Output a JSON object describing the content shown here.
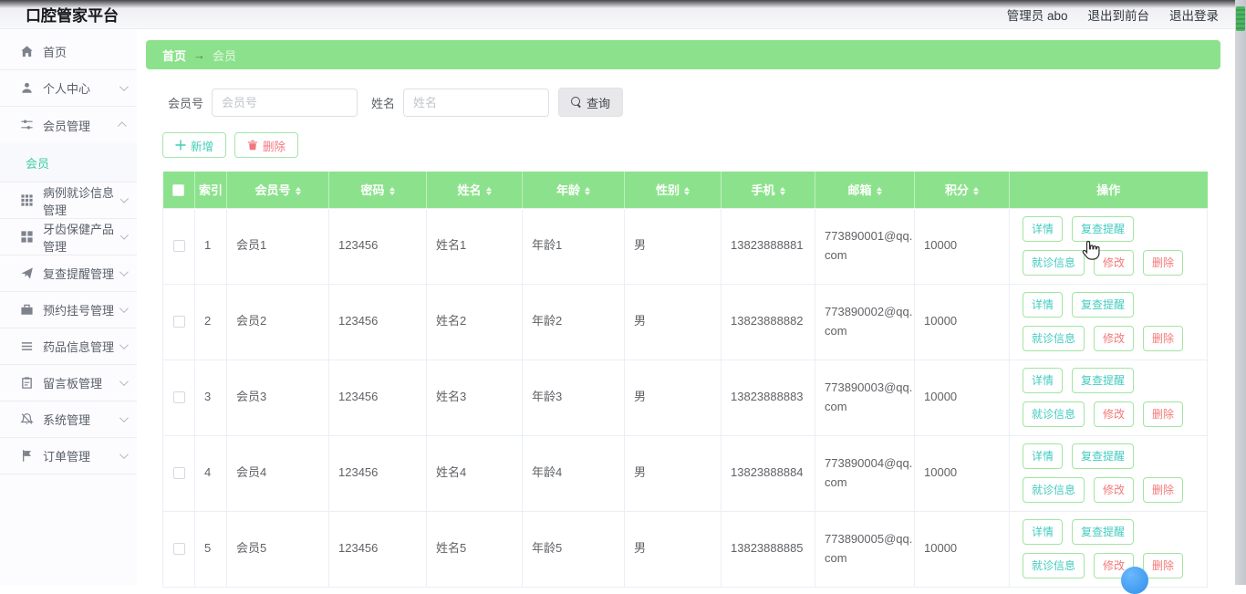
{
  "header": {
    "title": "口腔管家平台",
    "user": "管理员 abo",
    "exit_front_label": "退出到前台",
    "logout_label": "退出登录"
  },
  "sidebar": {
    "items": [
      {
        "label": "首页",
        "icon": "home-icon"
      },
      {
        "label": "个人中心",
        "icon": "user-icon"
      },
      {
        "label": "会员管理",
        "icon": "sliders-icon",
        "expanded": true,
        "children": [
          {
            "label": "会员",
            "active": true
          }
        ]
      },
      {
        "label": "病例就诊信息管理",
        "icon": "grid-icon"
      },
      {
        "label": "牙齿保健产品管理",
        "icon": "blocks-icon"
      },
      {
        "label": "复查提醒管理",
        "icon": "send-icon"
      },
      {
        "label": "预约挂号管理",
        "icon": "briefcase-icon"
      },
      {
        "label": "药品信息管理",
        "icon": "list-icon"
      },
      {
        "label": "留言板管理",
        "icon": "clipboard-icon"
      },
      {
        "label": "系统管理",
        "icon": "bell-icon"
      },
      {
        "label": "订单管理",
        "icon": "flag-icon"
      }
    ]
  },
  "breadcrumb": {
    "home": "首页",
    "arrow": "→",
    "current": "会员"
  },
  "search": {
    "member_label": "会员号",
    "member_placeholder": "会员号",
    "name_label": "姓名",
    "name_placeholder": "姓名",
    "query_label": "查询"
  },
  "toolbar": {
    "add_label": "新增",
    "delete_label": "删除"
  },
  "table": {
    "columns": [
      "索引",
      "会员号",
      "密码",
      "姓名",
      "年龄",
      "性别",
      "手机",
      "邮箱",
      "积分",
      "操作"
    ],
    "action_labels": [
      "详情",
      "复查提醒",
      "就诊信息",
      "修改",
      "删除"
    ],
    "rows": [
      {
        "idx": "1",
        "member_no": "会员1",
        "password": "123456",
        "name": "姓名1",
        "age": "年龄1",
        "gender": "男",
        "phone": "13823888881",
        "email": "773890001@qq.com",
        "points": "10000"
      },
      {
        "idx": "2",
        "member_no": "会员2",
        "password": "123456",
        "name": "姓名2",
        "age": "年龄2",
        "gender": "男",
        "phone": "13823888882",
        "email": "773890002@qq.com",
        "points": "10000"
      },
      {
        "idx": "3",
        "member_no": "会员3",
        "password": "123456",
        "name": "姓名3",
        "age": "年龄3",
        "gender": "男",
        "phone": "13823888883",
        "email": "773890003@qq.com",
        "points": "10000"
      },
      {
        "idx": "4",
        "member_no": "会员4",
        "password": "123456",
        "name": "姓名4",
        "age": "年龄4",
        "gender": "男",
        "phone": "13823888884",
        "email": "773890004@qq.com",
        "points": "10000"
      },
      {
        "idx": "5",
        "member_no": "会员5",
        "password": "123456",
        "name": "姓名5",
        "age": "年龄5",
        "gender": "男",
        "phone": "13823888885",
        "email": "773890005@qq.com",
        "points": "10000"
      }
    ]
  },
  "colors": {
    "accent_green": "#8ce28c",
    "active_teal": "#3fcfa3",
    "action_teal": "#44cbc0",
    "danger_pink": "#f27979",
    "fab_blue": "#3da2ff"
  }
}
